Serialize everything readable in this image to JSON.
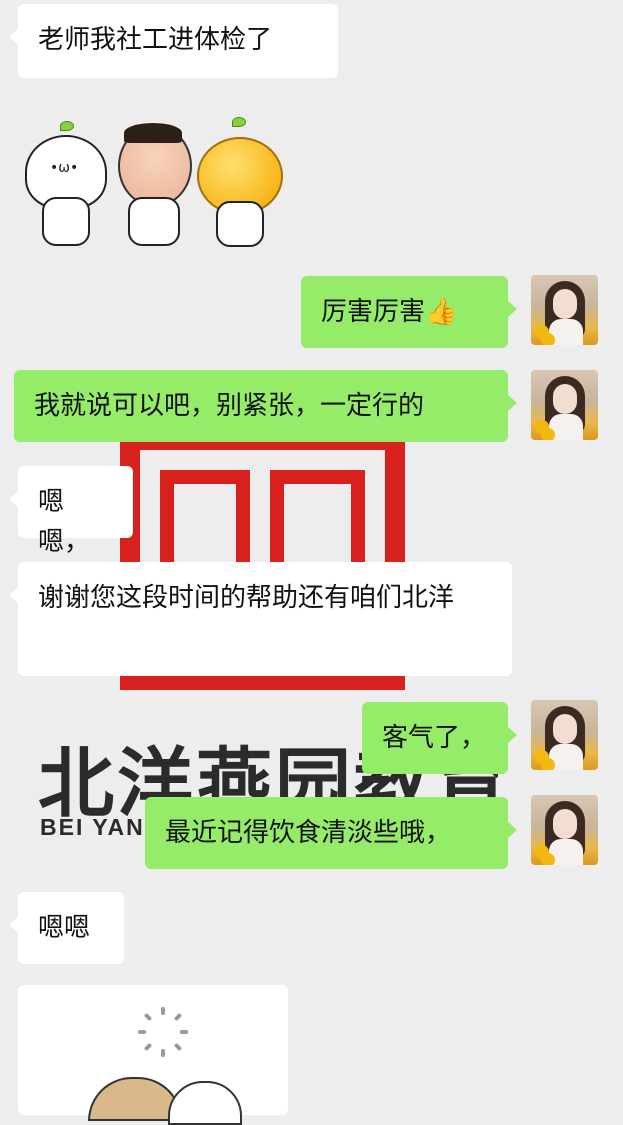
{
  "messages": [
    {
      "side": "left",
      "text": "老师我社工进体检了"
    },
    {
      "side": "right",
      "text": "厉害厉害👍"
    },
    {
      "side": "right",
      "text": "我就说可以吧，别紧张，一定行的"
    },
    {
      "side": "left",
      "text": "嗯嗯，"
    },
    {
      "side": "left",
      "text": "谢谢您这段时间的帮助还有咱们北洋"
    },
    {
      "side": "right",
      "text": "客气了，"
    },
    {
      "side": "right",
      "text": "最近记得饮食清淡些哦，"
    },
    {
      "side": "left",
      "text": "嗯嗯"
    }
  ],
  "watermark": {
    "cn": "北洋燕园教育",
    "en": "BEI YAN"
  },
  "stickers": {
    "left_sticker": "sprout-buddies-sticker",
    "bottom_sticker": "loading-sticker"
  },
  "colors": {
    "background": "#ededed",
    "sent_bubble": "#95ec69",
    "received_bubble": "#ffffff",
    "watermark_red": "#d8201d"
  }
}
